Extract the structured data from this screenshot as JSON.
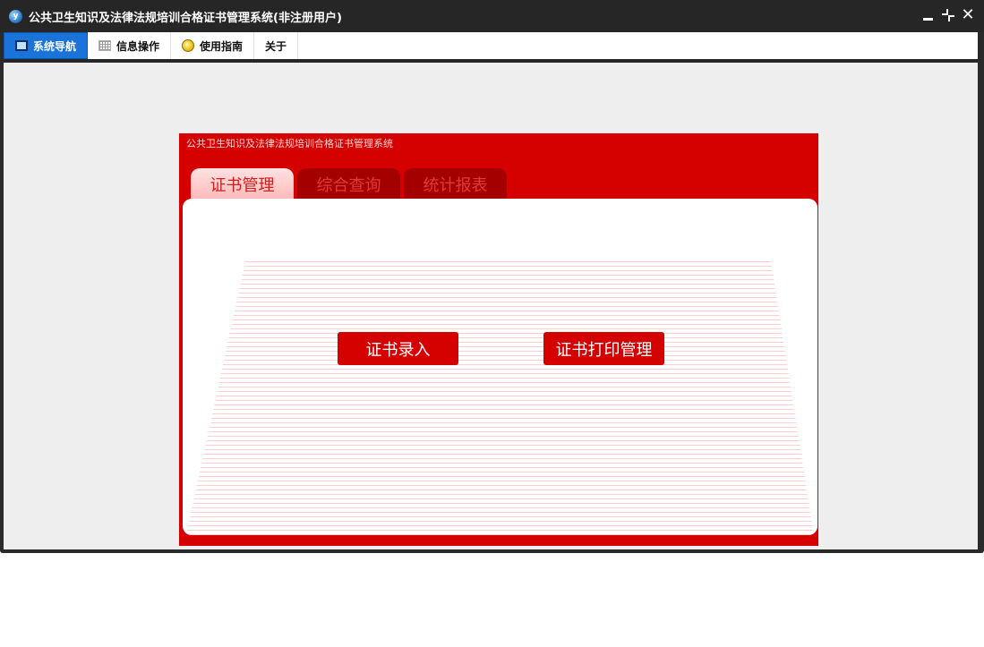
{
  "window": {
    "title": "公共卫生知识及法律法规培训合格证书管理系统(非注册用户)",
    "app_icon": "y"
  },
  "menubar": {
    "items": [
      {
        "label": "系统导航",
        "icon": "monitor-icon",
        "active": true
      },
      {
        "label": "信息操作",
        "icon": "grid-icon",
        "active": false
      },
      {
        "label": "使用指南",
        "icon": "lightbulb-icon",
        "active": false
      },
      {
        "label": "关于",
        "icon": "",
        "active": false
      }
    ]
  },
  "panel": {
    "title": "公共卫生知识及法律法规培训合格证书管理系统",
    "tabs": [
      {
        "label": "证书管理",
        "active": true
      },
      {
        "label": "综合查询",
        "active": false
      },
      {
        "label": "统计报表",
        "active": false
      }
    ],
    "buttons": {
      "entry": "证书录入",
      "print": "证书打印管理"
    }
  },
  "colors": {
    "accent_red": "#d50000",
    "menu_active_blue": "#1a73d9",
    "titlebar": "#262626"
  }
}
